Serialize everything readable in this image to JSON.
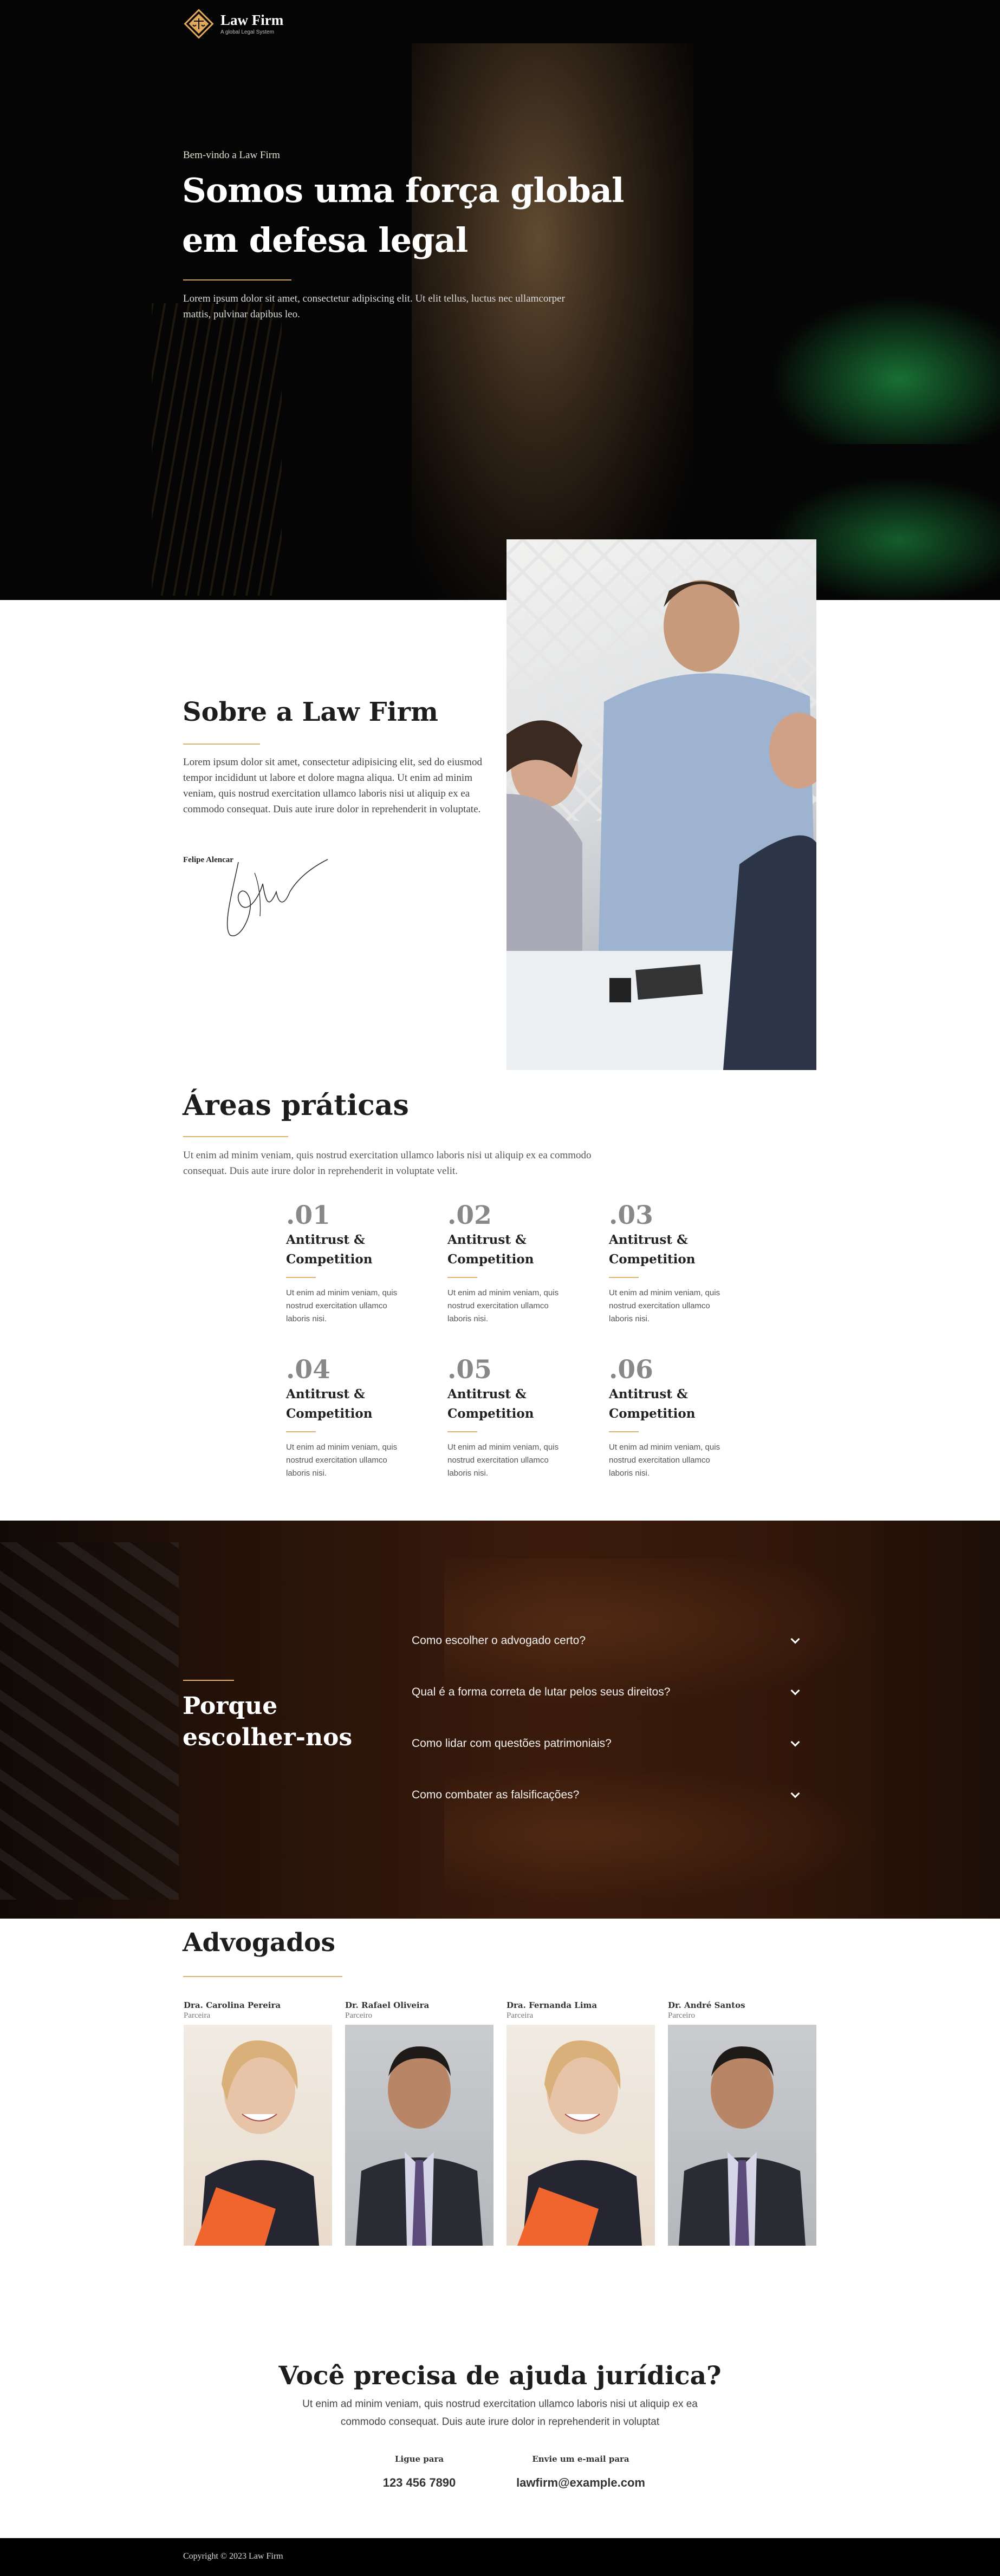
{
  "brand": {
    "name": "Law Firm",
    "tagline": "A global Legal System"
  },
  "hero": {
    "kicker": "Bem-vindo a Law Firm",
    "title_line1": "Somos uma força global",
    "title_line2": "em defesa legal",
    "body": "Lorem ipsum dolor sit amet, consectetur adipiscing elit. Ut elit tellus, luctus nec ullamcorper mattis, pulvinar dapibus leo."
  },
  "about": {
    "title": "Sobre a Law Firm",
    "body": "Lorem ipsum dolor sit amet, consectetur adipisicing elit, sed do eiusmod tempor incididunt ut labore et dolore magna aliqua. Ut enim ad minim veniam, quis nostrud exercitation ullamco laboris nisi ut aliquip ex ea commodo consequat. Duis aute irure dolor in reprehenderit in voluptate.",
    "signer": "Felipe Alencar"
  },
  "practice": {
    "title": "Áreas práticas",
    "intro": "Ut enim ad minim veniam, quis nostrud exercitation ullamco laboris nisi ut aliquip ex ea commodo consequat. Duis aute irure dolor in reprehenderit in voluptate velit.",
    "items": [
      {
        "num": ".01",
        "title1": "Antitrust &",
        "title2": "Competition",
        "body": "Ut enim ad minim veniam, quis nostrud exercitation ullamco laboris nisi."
      },
      {
        "num": ".02",
        "title1": "Antitrust &",
        "title2": "Competition",
        "body": "Ut enim ad minim veniam, quis nostrud exercitation ullamco laboris nisi."
      },
      {
        "num": ".03",
        "title1": "Antitrust &",
        "title2": "Competition",
        "body": "Ut enim ad minim veniam, quis nostrud exercitation ullamco laboris nisi."
      },
      {
        "num": ".04",
        "title1": "Antitrust &",
        "title2": "Competition",
        "body": "Ut enim ad minim veniam, quis nostrud exercitation ullamco laboris nisi."
      },
      {
        "num": ".05",
        "title1": "Antitrust &",
        "title2": "Competition",
        "body": "Ut enim ad minim veniam, quis nostrud exercitation ullamco laboris nisi."
      },
      {
        "num": ".06",
        "title1": "Antitrust &",
        "title2": "Competition",
        "body": "Ut enim ad minim veniam, quis nostrud exercitation ullamco laboris nisi."
      }
    ]
  },
  "why": {
    "title_line1": "Porque",
    "title_line2": "escolher-nos",
    "faqs": [
      "Como escolher o advogado certo?",
      "Qual é a forma correta de lutar pelos seus direitos?",
      "Como lidar com questões patrimoniais?",
      "Como combater as falsificações?"
    ]
  },
  "lawyers": {
    "title": "Advogados",
    "items": [
      {
        "name": "Dra. Carolina Pereira",
        "role": "Parceira"
      },
      {
        "name": "Dr. Rafael Oliveira",
        "role": "Parceiro"
      },
      {
        "name": "Dra. Fernanda Lima",
        "role": "Parceira"
      },
      {
        "name": "Dr. André Santos",
        "role": "Parceiro"
      }
    ]
  },
  "contact": {
    "title": "Você precisa de ajuda jurídica?",
    "body": "Ut enim ad minim veniam, quis nostrud exercitation ullamco laboris nisi ut aliquip ex ea commodo consequat. Duis aute irure dolor in reprehenderit in voluptat",
    "phone_label": "Ligue para",
    "phone": "123 456 7890",
    "email_label": "Envie um e-mail para",
    "email": "lawfirm@example.com"
  },
  "footer": {
    "copyright": "Copyright © 2023 Law Firm"
  },
  "colors": {
    "accent": "#e0b070",
    "dark": "#050505",
    "text": "#1d1d1d"
  },
  "icons": [
    "scales-logo-icon",
    "chevron-down-icon"
  ]
}
